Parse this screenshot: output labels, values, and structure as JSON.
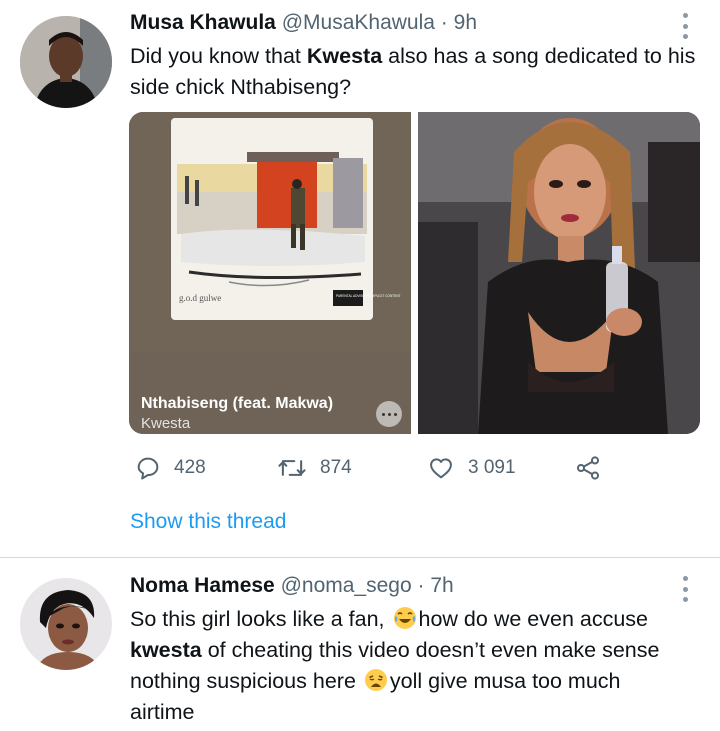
{
  "tweet1": {
    "author_name": "Musa Khawula",
    "handle": "@MusaKhawula",
    "separator": "·",
    "time": "9h",
    "text_parts": [
      "Did you know that ",
      "Kwesta",
      " also has a song dedicated to his side chick Nthabiseng?"
    ],
    "album": {
      "cover_text": "g.o.d gulwe",
      "advisory_text": "PARENTAL ADVISORY EXPLICIT CONTENT",
      "song_title": "Nthabiseng (feat. Makwa)",
      "artist": "Kwesta"
    },
    "reply_count": "428",
    "retweet_count": "874",
    "like_count": "3 091",
    "show_thread": "Show this thread"
  },
  "tweet2": {
    "author_name": "Noma Hamese",
    "handle": "@noma_sego",
    "separator": "·",
    "time": "7h",
    "line1": "So this girl looks like a fan, ",
    "line1b": "how do we even accuse",
    "line2_bold": "kwesta",
    "line2": " of cheating this video doesn’t even make sense",
    "line3": "nothing suspicious here ",
    "line3b": "yoll give musa too much",
    "line4": "airtime"
  },
  "icons": [
    "more-icon",
    "reply-icon",
    "retweet-icon",
    "like-icon",
    "share-icon",
    "laughing-emoji-icon",
    "weary-emoji-icon"
  ],
  "colors": {
    "link": "#1d9bf0",
    "secondary": "#536471",
    "text": "#0f1419",
    "divider": "#cfd9de"
  }
}
